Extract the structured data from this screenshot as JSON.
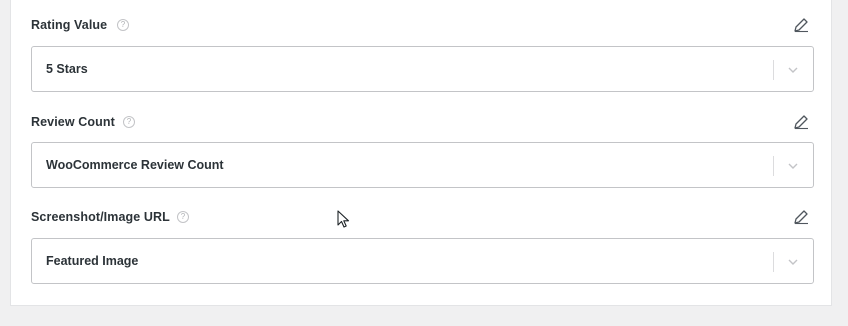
{
  "fields": [
    {
      "label": "Rating Value",
      "value": "5 Stars"
    },
    {
      "label": "Review Count",
      "value": "WooCommerce Review Count"
    },
    {
      "label": "Screenshot/Image URL",
      "value": "Featured Image"
    }
  ],
  "help_glyph": "?",
  "icons": {
    "help": "question-circle-icon",
    "edit": "pencil-icon",
    "dropdown": "chevron-down-icon",
    "cursor": "mouse-pointer-icon"
  },
  "colors": {
    "background": "#f0f0f1",
    "panel": "#ffffff",
    "border": "#c3c4c7",
    "text": "#2c3338"
  }
}
